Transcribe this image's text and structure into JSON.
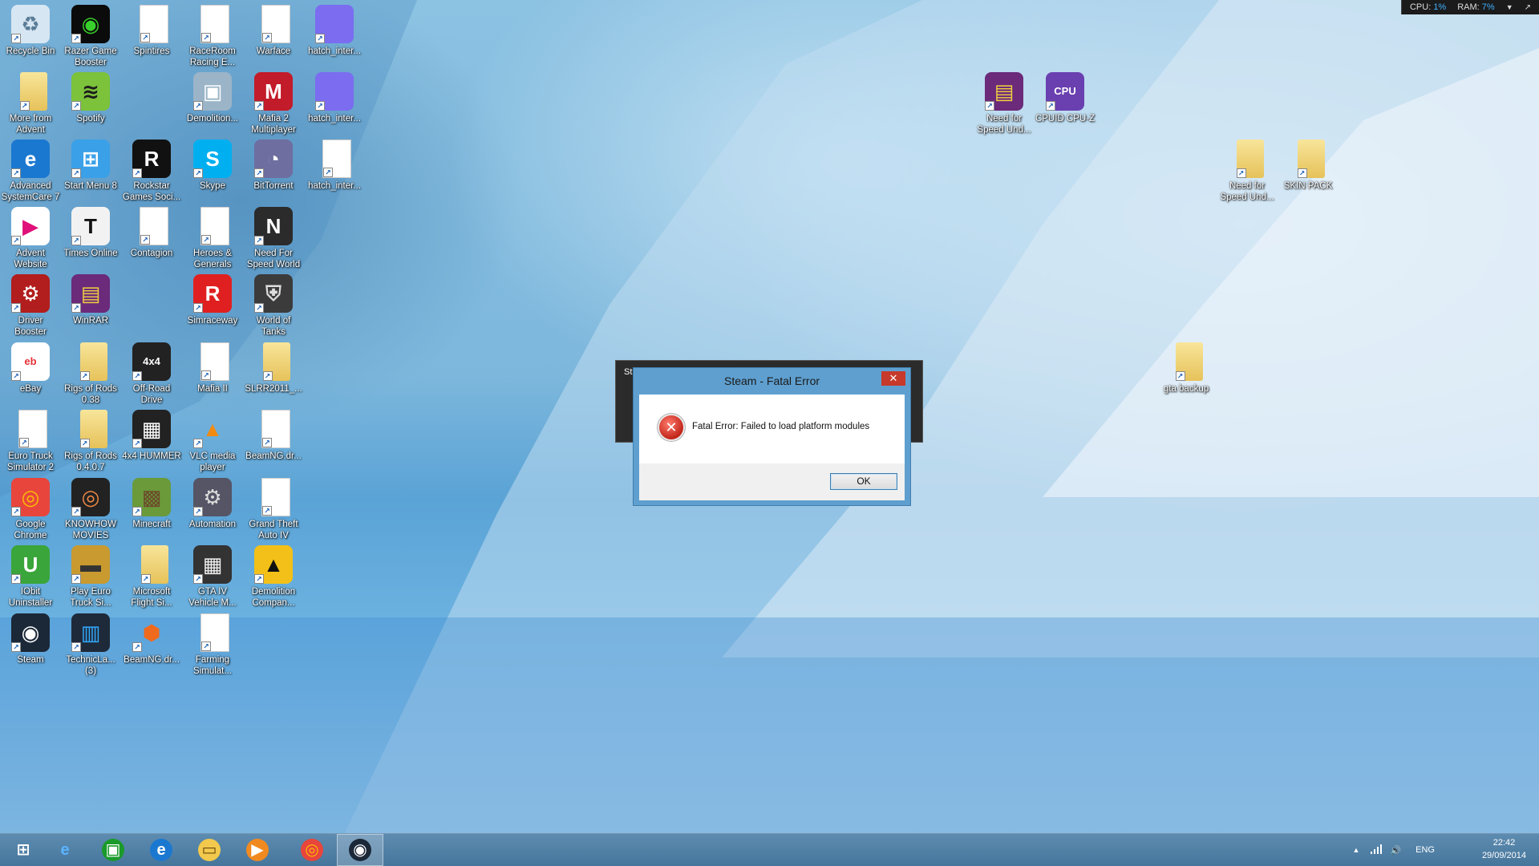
{
  "meter": {
    "cpu_label": "CPU:",
    "cpu_value": "1%",
    "ram_label": "RAM:",
    "ram_value": "7%"
  },
  "desktop_icons": [
    {
      "label": "Recycle Bin",
      "icon": "recycle-bin-icon"
    },
    {
      "label": "Razer Game\nBooster",
      "icon": "razer-icon"
    },
    {
      "label": "Spintires",
      "icon": "document-icon"
    },
    {
      "label": "RaceRoom\nRacing E...",
      "icon": "document-icon"
    },
    {
      "label": "Warface",
      "icon": "document-icon"
    },
    {
      "label": "hatch_inter...",
      "icon": "image-icon"
    },
    {
      "label": "More from\nAdvent",
      "icon": "folder-icon"
    },
    {
      "label": "Spotify",
      "icon": "spotify-icon"
    },
    {
      "label": "Demolition...",
      "icon": "app-icon"
    },
    {
      "label": "Mafia 2\nMultiplayer",
      "icon": "mafia-icon"
    },
    {
      "label": "hatch_inter...",
      "icon": "image-icon"
    },
    {
      "label": "Advanced\nSystemCare 7",
      "icon": "systemcare-icon"
    },
    {
      "label": "Start Menu 8",
      "icon": "start-menu-icon"
    },
    {
      "label": "Rockstar\nGames Soci...",
      "icon": "rockstar-icon"
    },
    {
      "label": "Skype",
      "icon": "skype-icon"
    },
    {
      "label": "BitTorrent",
      "icon": "bittorrent-icon"
    },
    {
      "label": "hatch_inter...",
      "icon": "document-icon"
    },
    {
      "label": "Advent\nWebsite",
      "icon": "advent-icon"
    },
    {
      "label": "Times Online",
      "icon": "times-icon"
    },
    {
      "label": "Contagion",
      "icon": "document-icon"
    },
    {
      "label": "Heroes &\nGenerals",
      "icon": "document-icon"
    },
    {
      "label": "Need For\nSpeed World",
      "icon": "nfs-icon"
    },
    {
      "label": "Driver\nBooster",
      "icon": "driver-booster-icon"
    },
    {
      "label": "WinRAR",
      "icon": "winrar-icon"
    },
    {
      "label": "Simraceway",
      "icon": "simraceway-icon"
    },
    {
      "label": "World of\nTanks",
      "icon": "wot-icon"
    },
    {
      "label": "eBay",
      "icon": "ebay-icon"
    },
    {
      "label": "Rigs of Rods\n0.38",
      "icon": "folder-icon"
    },
    {
      "label": "Off-Road\nDrive",
      "icon": "offroad-icon"
    },
    {
      "label": "Mafia II",
      "icon": "document-icon"
    },
    {
      "label": "SLRR2011_...",
      "icon": "folder-icon"
    },
    {
      "label": "Euro Truck\nSimulator 2",
      "icon": "document-icon"
    },
    {
      "label": "Rigs of Rods\n0.4.0.7",
      "icon": "folder-icon"
    },
    {
      "label": "4x4 HUMMER",
      "icon": "hummer-icon"
    },
    {
      "label": "VLC media\nplayer",
      "icon": "vlc-icon"
    },
    {
      "label": "BeamNG.dr...",
      "icon": "document-icon"
    },
    {
      "label": "Google\nChrome",
      "icon": "chrome-icon"
    },
    {
      "label": "KNOWHOW\nMOVIES",
      "icon": "knowhow-icon"
    },
    {
      "label": "Minecraft",
      "icon": "minecraft-icon"
    },
    {
      "label": "Automation",
      "icon": "automation-icon"
    },
    {
      "label": "Grand Theft\nAuto IV",
      "icon": "document-icon"
    },
    {
      "label": "IObit\nUninstaller",
      "icon": "iobit-icon"
    },
    {
      "label": "Play Euro\nTruck Si...",
      "icon": "ets-icon"
    },
    {
      "label": "Microsoft\nFlight Si...",
      "icon": "folder-icon"
    },
    {
      "label": "GTA IV\nVehicle M...",
      "icon": "gta-icon"
    },
    {
      "label": "Demolition\nCompan...",
      "icon": "demolition-icon"
    },
    {
      "label": "Steam",
      "icon": "steam-icon"
    },
    {
      "label": "TechnicLa...\n(3)",
      "icon": "technic-icon"
    },
    {
      "label": "BeamNG.dr...",
      "icon": "beamng-icon"
    },
    {
      "label": "Farming\nSimulat...",
      "icon": "document-icon"
    },
    {
      "label": "Need for\nSpeed Und...",
      "icon": "winrar-icon"
    },
    {
      "label": "CPUID CPU-Z",
      "icon": "cpuz-icon"
    },
    {
      "label": "Need for\nSpeed Und...",
      "icon": "folder-icon"
    },
    {
      "label": "SKIN PACK",
      "icon": "folder-icon"
    },
    {
      "label": "gta backup",
      "icon": "folder-icon"
    }
  ],
  "behind_window": {
    "title": "St"
  },
  "dialog": {
    "title": "Steam - Fatal Error",
    "close_label": "✕",
    "message": "Fatal Error: Failed to load platform modules",
    "ok_label": "OK"
  },
  "taskbar": {
    "items": [
      {
        "icon": "windows-start-icon"
      },
      {
        "icon": "internet-explorer-icon"
      },
      {
        "icon": "store-icon"
      },
      {
        "icon": "systemcare-icon"
      },
      {
        "icon": "file-explorer-icon"
      },
      {
        "icon": "media-player-icon"
      },
      {
        "icon": "chrome-icon"
      },
      {
        "icon": "steam-icon",
        "active": true
      }
    ],
    "tray": {
      "language": "ENG",
      "time": "22:42",
      "date": "29/09/2014"
    }
  },
  "colors": {
    "dialog_frame": "#5e9fcf",
    "close_button": "#c7392a",
    "taskbar": "#4f82aa",
    "meter_value": "#3fb0ff"
  }
}
